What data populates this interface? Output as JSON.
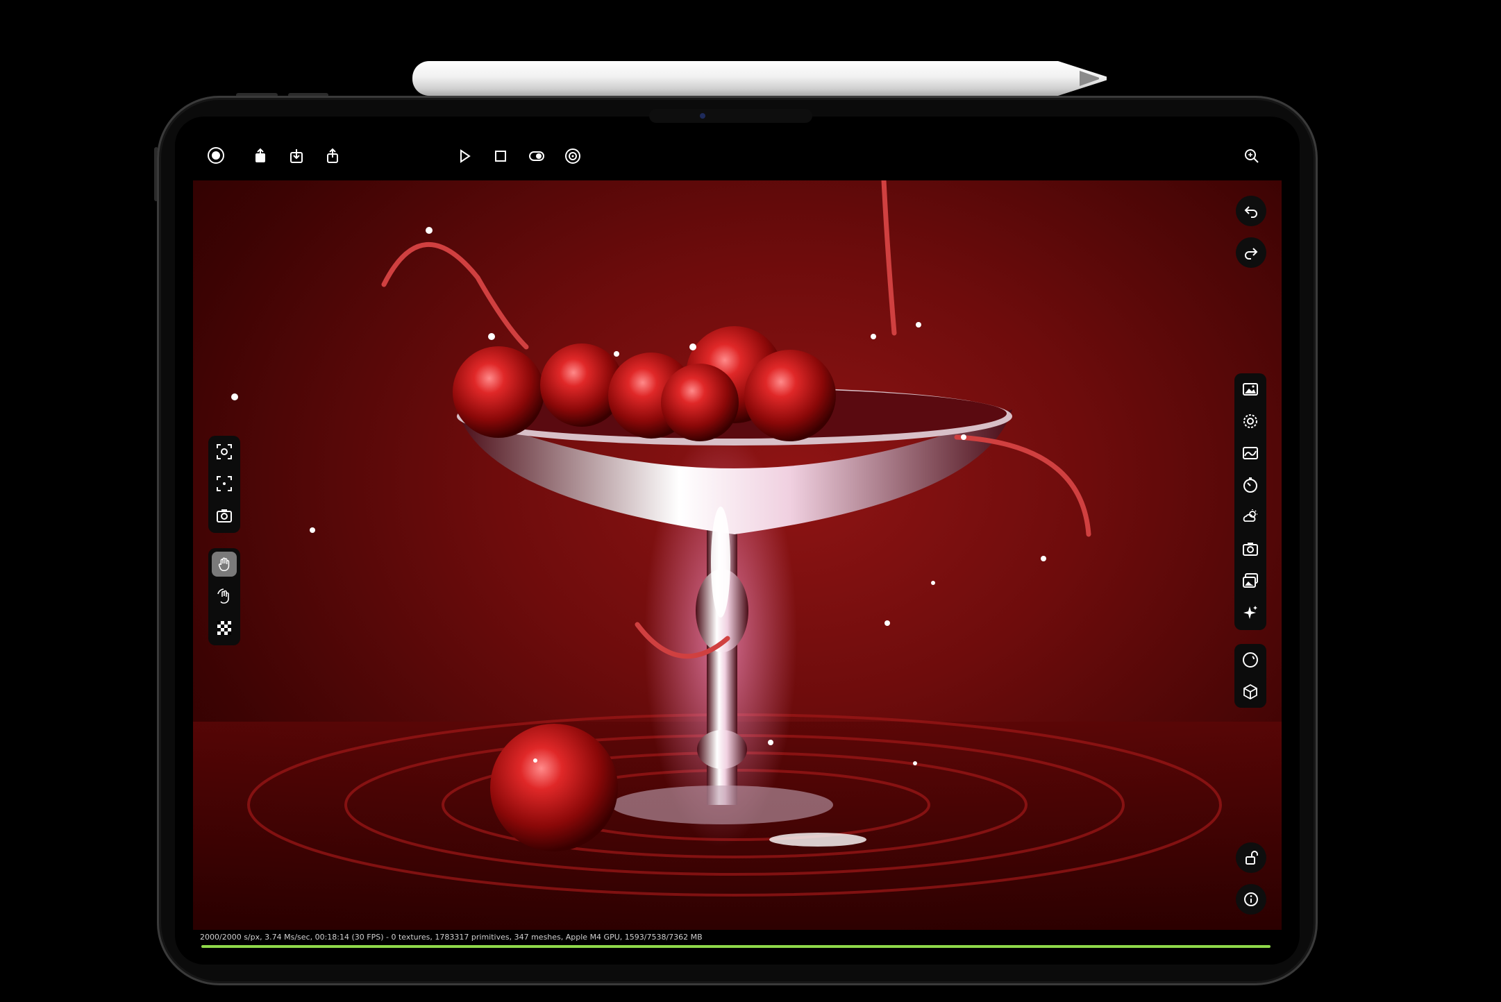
{
  "toolbar": {
    "left": [
      "logo-icon",
      "upload-icon",
      "import-icon",
      "share-icon"
    ],
    "center": [
      "play-icon",
      "stop-icon",
      "toggle-icon",
      "target-icon"
    ],
    "right": [
      "zoom-icon"
    ]
  },
  "history": [
    "undo-icon",
    "redo-icon"
  ],
  "left_panel_camera": [
    "frame-selection-icon",
    "focus-icon",
    "camera-rotate-icon"
  ],
  "left_panel_tools": [
    "hand-icon",
    "orbit-icon",
    "checkerboard-icon"
  ],
  "right_panel": [
    "image-icon",
    "settings-icon",
    "exposure-icon",
    "timer-icon",
    "weather-icon",
    "camera-icon",
    "gallery-icon",
    "sparkle-icon"
  ],
  "right_panel_view": [
    "material-ball-icon",
    "cube-icon"
  ],
  "bottom_right": [
    "unlock-icon",
    "info-icon"
  ],
  "status": {
    "text": "2000/2000 s/px, 3.74 Ms/sec, 00:18:14 (30 FPS) - 0 textures, 1783317 primitives, 347 meshes, Apple M4 GPU, 1593/7538/7362 MB",
    "progress": 1.0
  },
  "colors": {
    "accent": "#8fd84a",
    "background": "#000000",
    "render_red": "#8f1414"
  }
}
